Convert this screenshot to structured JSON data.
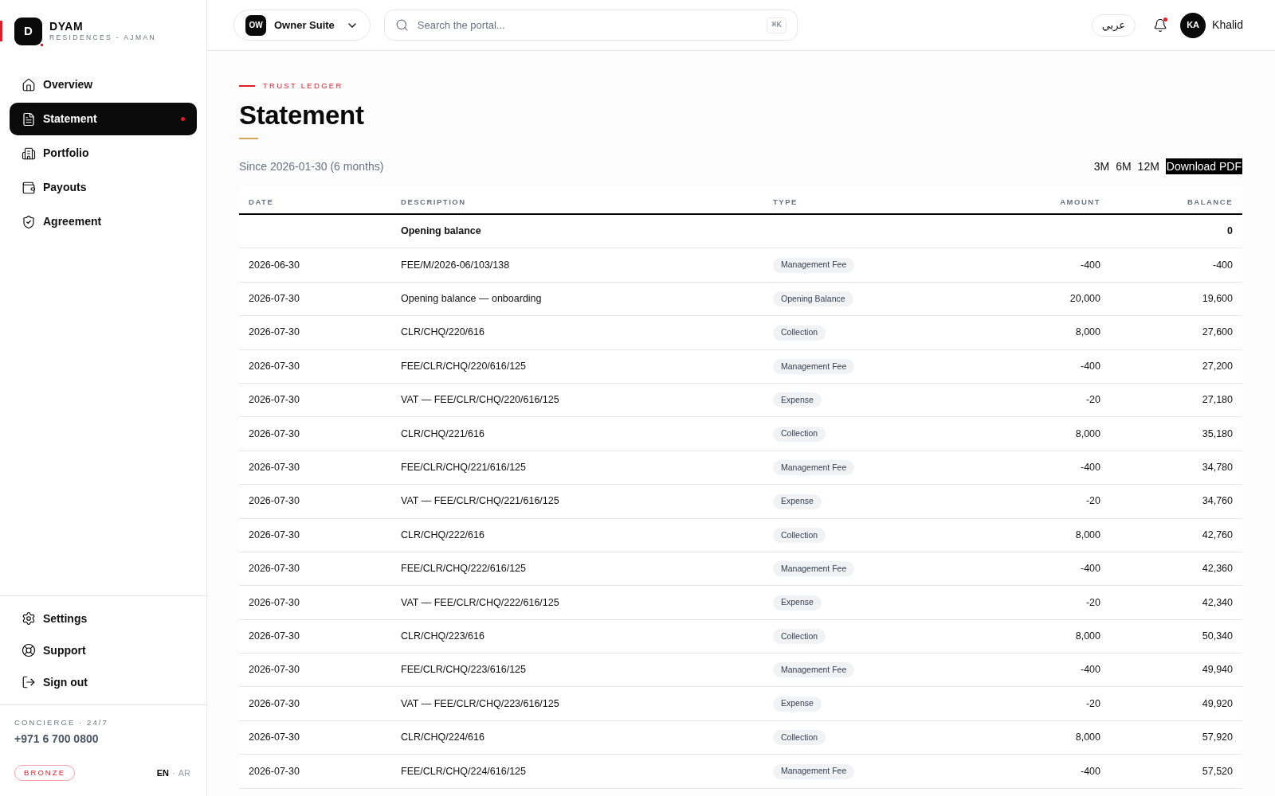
{
  "sidebar": {
    "brand": {
      "mark": "D",
      "name": "DYAM",
      "tagline": "RESIDENCES - AJMAN"
    },
    "nav": [
      {
        "label": "Overview",
        "selected": false,
        "dot": false
      },
      {
        "label": "Statement",
        "selected": true,
        "dot": true
      },
      {
        "label": "Portfolio",
        "selected": false,
        "dot": false
      },
      {
        "label": "Payouts",
        "selected": false,
        "dot": false
      },
      {
        "label": "Agreement",
        "selected": false,
        "dot": false
      }
    ],
    "footer_nav": [
      {
        "label": "Settings"
      },
      {
        "label": "Support"
      },
      {
        "label": "Sign out"
      }
    ],
    "concierge": {
      "label": "CONCIERGE · 24/7",
      "phone": "+971 6 700 0800"
    },
    "tier": "BRONZE",
    "languages": {
      "items": [
        {
          "label": "EN",
          "selected": true
        },
        {
          "label": "AR",
          "selected": false
        }
      ],
      "separator": "·"
    }
  },
  "topbar": {
    "workspace": {
      "mark": "OW",
      "name": "Owner Suite"
    },
    "search": {
      "placeholder": "Search the portal...",
      "shortcut": "⌘K"
    },
    "language_button": "عربي",
    "notifications": true,
    "user": {
      "initials": "KA",
      "name": "Khalid"
    }
  },
  "page": {
    "eyebrow": "TRUST LEDGER",
    "title": "Statement",
    "period": "Since 2026-01-30 (6 months)",
    "ranges": [
      "3M",
      "6M",
      "12M"
    ],
    "download": "Download PDF"
  },
  "table": {
    "columns": [
      "DATE",
      "DESCRIPTION",
      "TYPE",
      "AMOUNT",
      "BALANCE"
    ],
    "rows": [
      {
        "kind": "opening",
        "description": "Opening balance",
        "balance": "0"
      },
      {
        "kind": "entry",
        "date": "2026-06-30",
        "description": "FEE/M/2026-06/103/138",
        "type": "Management Fee",
        "amount": "-400",
        "balance": "-400"
      },
      {
        "kind": "entry",
        "date": "2026-07-30",
        "description": "Opening balance — onboarding",
        "type": "Opening Balance",
        "amount": "20,000",
        "balance": "19,600"
      },
      {
        "kind": "entry",
        "date": "2026-07-30",
        "description": "CLR/CHQ/220/616",
        "type": "Collection",
        "amount": "8,000",
        "balance": "27,600"
      },
      {
        "kind": "entry",
        "date": "2026-07-30",
        "description": "FEE/CLR/CHQ/220/616/125",
        "type": "Management Fee",
        "amount": "-400",
        "balance": "27,200"
      },
      {
        "kind": "entry",
        "date": "2026-07-30",
        "description": "VAT — FEE/CLR/CHQ/220/616/125",
        "type": "Expense",
        "amount": "-20",
        "balance": "27,180"
      },
      {
        "kind": "entry",
        "date": "2026-07-30",
        "description": "CLR/CHQ/221/616",
        "type": "Collection",
        "amount": "8,000",
        "balance": "35,180"
      },
      {
        "kind": "entry",
        "date": "2026-07-30",
        "description": "FEE/CLR/CHQ/221/616/125",
        "type": "Management Fee",
        "amount": "-400",
        "balance": "34,780"
      },
      {
        "kind": "entry",
        "date": "2026-07-30",
        "description": "VAT — FEE/CLR/CHQ/221/616/125",
        "type": "Expense",
        "amount": "-20",
        "balance": "34,760"
      },
      {
        "kind": "entry",
        "date": "2026-07-30",
        "description": "CLR/CHQ/222/616",
        "type": "Collection",
        "amount": "8,000",
        "balance": "42,760"
      },
      {
        "kind": "entry",
        "date": "2026-07-30",
        "description": "FEE/CLR/CHQ/222/616/125",
        "type": "Management Fee",
        "amount": "-400",
        "balance": "42,360"
      },
      {
        "kind": "entry",
        "date": "2026-07-30",
        "description": "VAT — FEE/CLR/CHQ/222/616/125",
        "type": "Expense",
        "amount": "-20",
        "balance": "42,340"
      },
      {
        "kind": "entry",
        "date": "2026-07-30",
        "description": "CLR/CHQ/223/616",
        "type": "Collection",
        "amount": "8,000",
        "balance": "50,340"
      },
      {
        "kind": "entry",
        "date": "2026-07-30",
        "description": "FEE/CLR/CHQ/223/616/125",
        "type": "Management Fee",
        "amount": "-400",
        "balance": "49,940"
      },
      {
        "kind": "entry",
        "date": "2026-07-30",
        "description": "VAT — FEE/CLR/CHQ/223/616/125",
        "type": "Expense",
        "amount": "-20",
        "balance": "49,920"
      },
      {
        "kind": "entry",
        "date": "2026-07-30",
        "description": "CLR/CHQ/224/616",
        "type": "Collection",
        "amount": "8,000",
        "balance": "57,920"
      },
      {
        "kind": "entry",
        "date": "2026-07-30",
        "description": "FEE/CLR/CHQ/224/616/125",
        "type": "Management Fee",
        "amount": "-400",
        "balance": "57,520"
      }
    ]
  }
}
